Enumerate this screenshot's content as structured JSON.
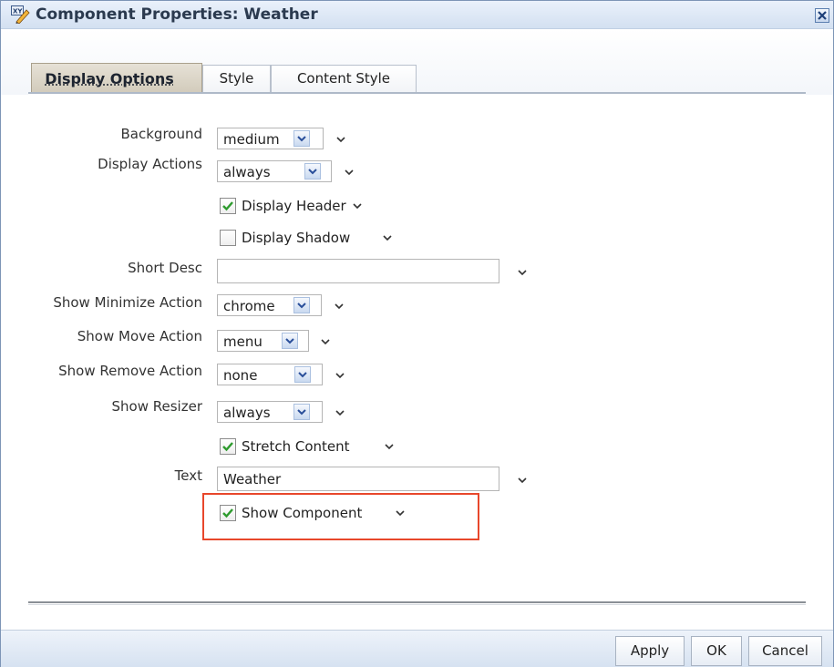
{
  "dialog": {
    "title": "Component Properties: Weather",
    "icon": "xy-pen-icon",
    "close_icon": "close-x-icon"
  },
  "tabs": [
    {
      "label": "Display Options",
      "selected": true
    },
    {
      "label": "Style",
      "selected": false
    },
    {
      "label": "Content Style",
      "selected": false
    }
  ],
  "fields": {
    "background": {
      "label": "Background",
      "value": "medium"
    },
    "display_actions": {
      "label": "Display Actions",
      "value": "always"
    },
    "display_header": {
      "label": "Display Header",
      "checked": true
    },
    "display_shadow": {
      "label": "Display Shadow",
      "checked": false
    },
    "short_desc": {
      "label": "Short Desc",
      "value": ""
    },
    "show_minimize_action": {
      "label": "Show Minimize Action",
      "value": "chrome"
    },
    "show_move_action": {
      "label": "Show Move Action",
      "value": "menu"
    },
    "show_remove_action": {
      "label": "Show Remove Action",
      "value": "none"
    },
    "show_resizer": {
      "label": "Show Resizer",
      "value": "always"
    },
    "stretch_content": {
      "label": "Stretch Content",
      "checked": true
    },
    "text": {
      "label": "Text",
      "value": "Weather"
    },
    "show_component": {
      "label": "Show Component",
      "checked": true
    }
  },
  "buttons": {
    "apply": "Apply",
    "ok": "OK",
    "cancel": "Cancel"
  },
  "colors": {
    "highlight_border": "#e8472b",
    "titlebar": "#d3e0f1",
    "checkmark": "#2e9b2e"
  }
}
